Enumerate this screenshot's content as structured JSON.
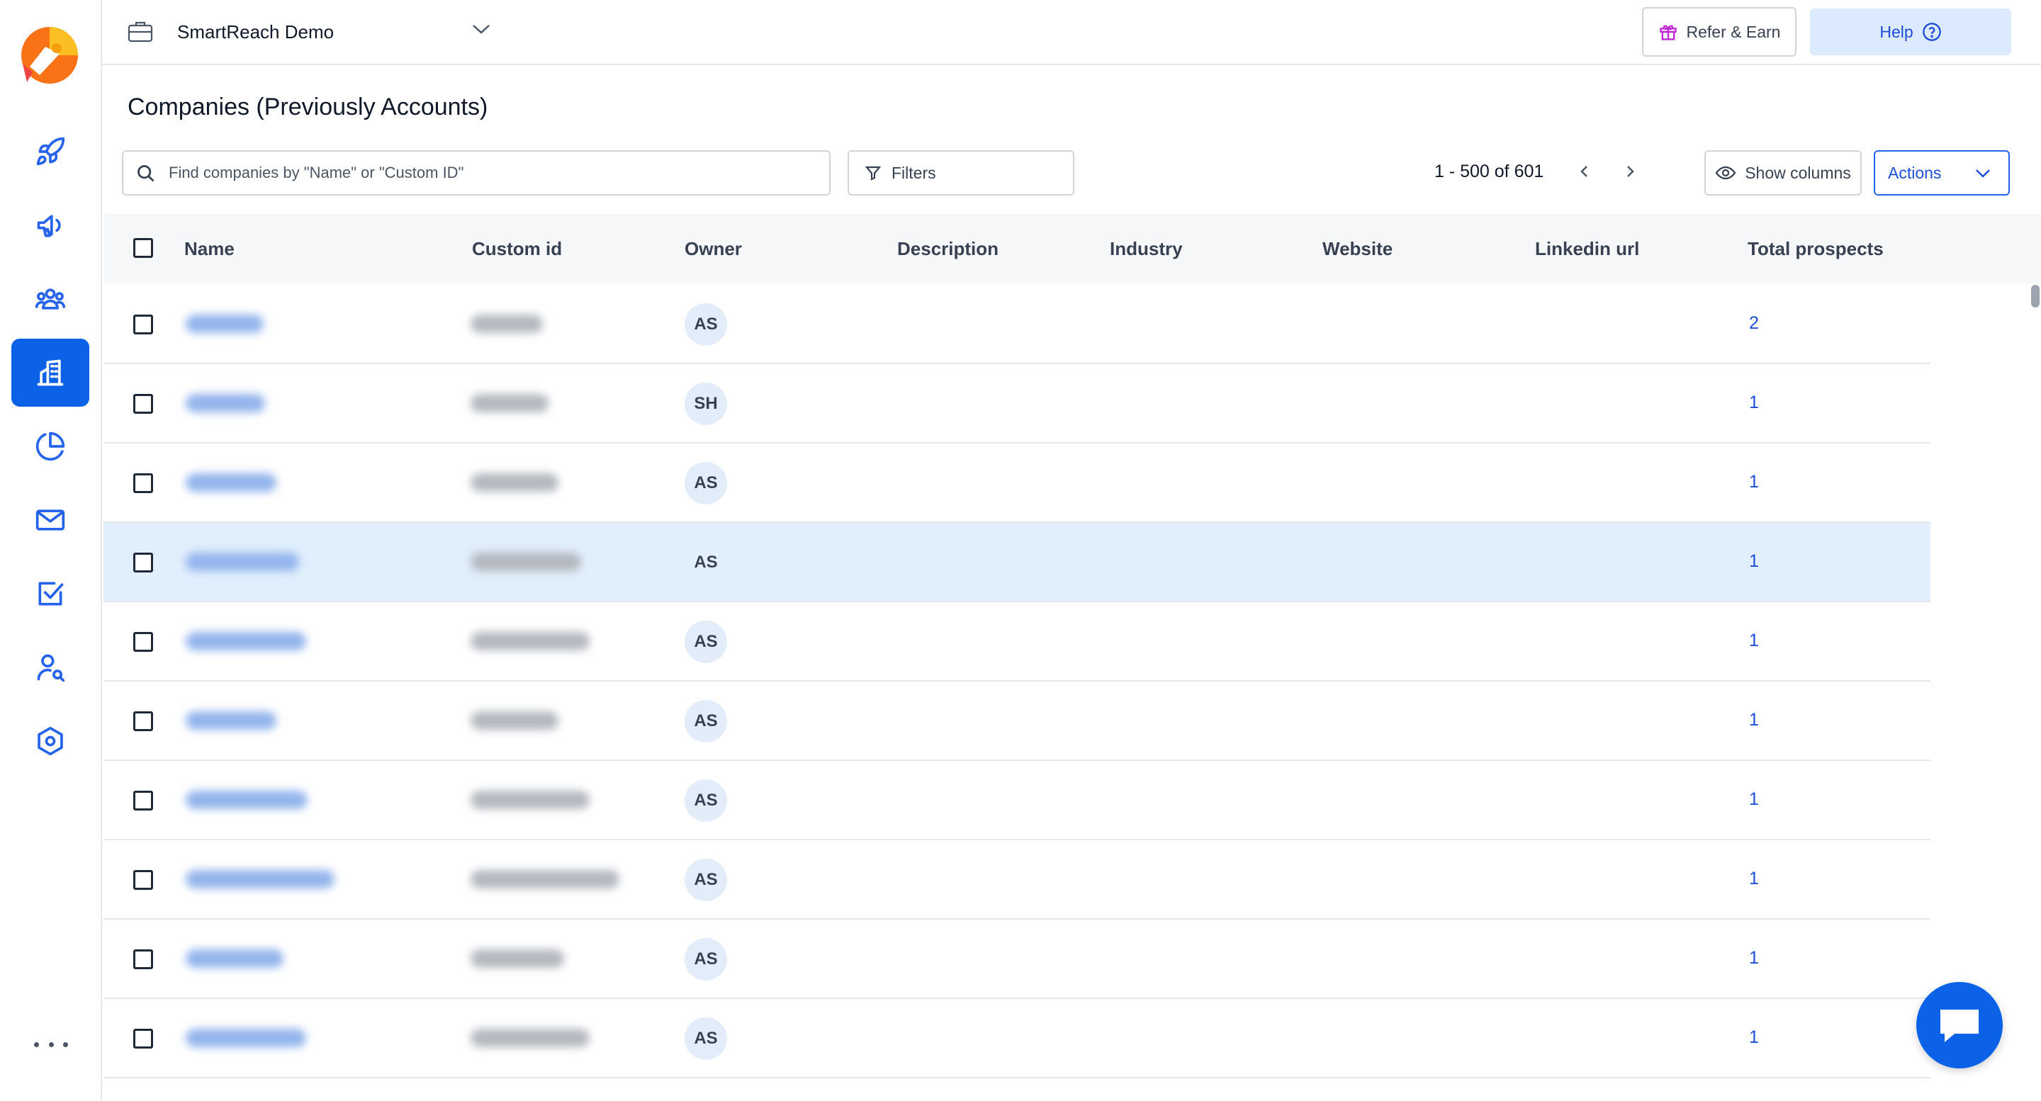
{
  "workspace": {
    "name": "SmartReach Demo"
  },
  "topbar": {
    "refer_label": "Refer & Earn",
    "help_label": "Help"
  },
  "page": {
    "title": "Companies (Previously Accounts)"
  },
  "toolbar": {
    "search_placeholder": "Find companies by \"Name\" or \"Custom ID\"",
    "filters_label": "Filters",
    "pagination": "1 - 500 of 601",
    "show_columns_label": "Show columns",
    "actions_label": "Actions"
  },
  "sidebar": {
    "items": [
      {
        "name": "rocket-icon",
        "active": false
      },
      {
        "name": "megaphone-icon",
        "active": false
      },
      {
        "name": "people-icon",
        "active": false
      },
      {
        "name": "building-icon",
        "active": true
      },
      {
        "name": "pie-chart-icon",
        "active": false
      },
      {
        "name": "mail-icon",
        "active": false
      },
      {
        "name": "checkbox-icon",
        "active": false
      },
      {
        "name": "person-search-icon",
        "active": false
      },
      {
        "name": "settings-hexagon-icon",
        "active": false
      }
    ]
  },
  "table": {
    "columns": [
      "Name",
      "Custom id",
      "Owner",
      "Description",
      "Industry",
      "Website",
      "Linkedin url",
      "Total prospects"
    ],
    "rows": [
      {
        "owner": "AS",
        "total_prospects": "2",
        "selected": false
      },
      {
        "owner": "SH",
        "total_prospects": "1",
        "selected": false
      },
      {
        "owner": "AS",
        "total_prospects": "1",
        "selected": false
      },
      {
        "owner": "AS",
        "total_prospects": "1",
        "selected": true
      },
      {
        "owner": "AS",
        "total_prospects": "1",
        "selected": false
      },
      {
        "owner": "AS",
        "total_prospects": "1",
        "selected": false
      },
      {
        "owner": "AS",
        "total_prospects": "1",
        "selected": false
      },
      {
        "owner": "AS",
        "total_prospects": "1",
        "selected": false
      },
      {
        "owner": "AS",
        "total_prospects": "1",
        "selected": false
      },
      {
        "owner": "AS",
        "total_prospects": "1",
        "selected": false
      }
    ]
  },
  "colors": {
    "accent": "#0b62e6",
    "link": "#1d4ed8",
    "selected_row": "#e1effd"
  }
}
